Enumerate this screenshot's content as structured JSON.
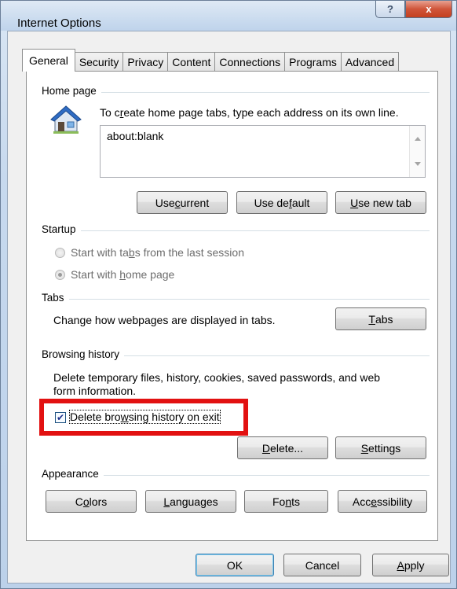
{
  "window": {
    "title": "Internet Options",
    "help_label": "?",
    "close_label": "x"
  },
  "tabs": [
    {
      "label": "General",
      "active": true
    },
    {
      "label": "Security"
    },
    {
      "label": "Privacy"
    },
    {
      "label": "Content"
    },
    {
      "label": "Connections"
    },
    {
      "label": "Programs"
    },
    {
      "label": "Advanced"
    }
  ],
  "home_page": {
    "group_label": "Home page",
    "instruction_pre": "To c",
    "instruction_ul": "r",
    "instruction_post": "eate home page tabs, type each address on its own line.",
    "address": "about:blank",
    "use_current": {
      "pre": "Use ",
      "ul": "c",
      "post": "urrent"
    },
    "use_default": {
      "pre": "Use de",
      "ul": "f",
      "post": "ault"
    },
    "use_new_tab": {
      "pre": "",
      "ul": "U",
      "post": "se new tab"
    }
  },
  "startup": {
    "group_label": "Startup",
    "option1": {
      "pre": "Start with ta",
      "ul": "b",
      "post": "s from the last session"
    },
    "option2": {
      "pre": "Start with ",
      "ul": "h",
      "post": "ome page"
    }
  },
  "tabs_section": {
    "group_label": "Tabs",
    "description": "Change how webpages are displayed in tabs.",
    "button": {
      "pre": "",
      "ul": "T",
      "post": "abs"
    }
  },
  "browsing_history": {
    "group_label": "Browsing history",
    "description_line1": "Delete temporary files, history, cookies, saved passwords, and web",
    "description_line2": "form information.",
    "checkbox": {
      "pre": "Delete bro",
      "ul": "w",
      "post": "sing history on exit",
      "checked": true
    },
    "delete_button": {
      "pre": "",
      "ul": "D",
      "post": "elete..."
    },
    "settings_button": {
      "pre": "",
      "ul": "S",
      "post": "ettings"
    }
  },
  "appearance": {
    "group_label": "Appearance",
    "colors": {
      "pre": "C",
      "ul": "o",
      "post": "lors"
    },
    "languages": {
      "pre": "",
      "ul": "L",
      "post": "anguages"
    },
    "fonts": {
      "pre": "Fo",
      "ul": "n",
      "post": "ts"
    },
    "accessibility": {
      "pre": "Acc",
      "ul": "e",
      "post": "ssibility"
    }
  },
  "footer": {
    "ok": "OK",
    "cancel": "Cancel",
    "apply": {
      "pre": "",
      "ul": "A",
      "post": "pply"
    }
  },
  "colors": {
    "highlight": "#e21111",
    "house_roof": "#2f6cc4"
  }
}
